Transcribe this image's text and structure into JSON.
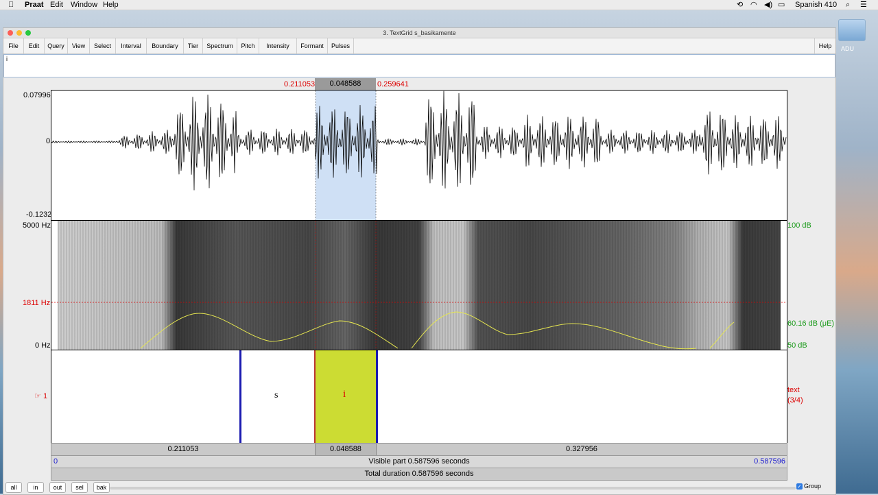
{
  "menubar": {
    "app": "Praat",
    "items": [
      "Edit",
      "Window",
      "Help"
    ],
    "status": "Spanish 410"
  },
  "desktop": {
    "icon_label": "ADU"
  },
  "window": {
    "title": "3. TextGrid s_basikamente",
    "menu": [
      "File",
      "Edit",
      "Query",
      "View",
      "Select",
      "Interval",
      "Boundary",
      "Tier",
      "Spectrum",
      "Pitch",
      "Intensity",
      "Formant",
      "Pulses"
    ],
    "help": "Help",
    "text_value": "i"
  },
  "selection": {
    "start": "0.211053",
    "duration": "0.048588",
    "end": "0.259641"
  },
  "waveform": {
    "max": "0.07996",
    "zero": "0",
    "min": "-0.1232"
  },
  "spectrogram": {
    "top_freq": "5000 Hz",
    "cursor_freq": "1811 Hz",
    "bottom_freq": "0 Hz",
    "intensity_max": "100 dB",
    "intensity_cursor": "60.16 dB (μE)",
    "intensity_min": "50 dB"
  },
  "tier": {
    "number": "1",
    "marker": "☞",
    "name": "text",
    "count": "(3/4)",
    "intervals": [
      "s",
      "i"
    ]
  },
  "durations": {
    "before": "0.211053",
    "selected": "0.048588",
    "after": "0.327956"
  },
  "visible": {
    "start": "0",
    "label": "Visible part 0.587596 seconds",
    "end": "0.587596"
  },
  "total": {
    "label": "Total duration 0.587596 seconds"
  },
  "bottom_buttons": [
    "all",
    "in",
    "out",
    "sel",
    "bak"
  ],
  "group": {
    "label": "Group",
    "checked": true
  },
  "colors": {
    "selection": "#cfe0f5",
    "interval_selected": "#ccdc33",
    "boundary": "#1b1bb0",
    "cursor": "#d00000",
    "pitch": "#e6e650"
  }
}
